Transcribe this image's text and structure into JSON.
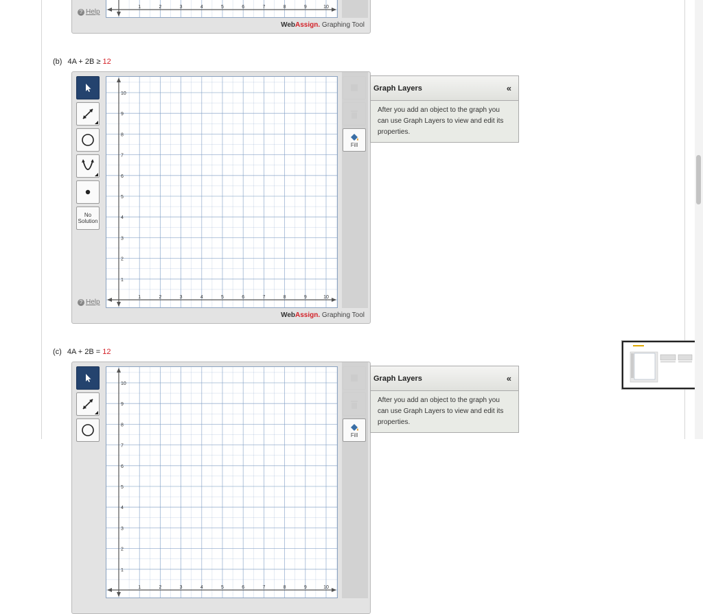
{
  "help_label": "Help",
  "brand": {
    "web": "Web",
    "assign": "Assign",
    "dot": ".",
    "rest": " Graphing Tool"
  },
  "no_solution": {
    "line1": "No",
    "line2": "Solution"
  },
  "fill_label": "Fill",
  "layers": {
    "title": "Graph Layers",
    "collapse": "«",
    "body": "After you add an object to the graph you can use Graph Layers to view and edit its properties."
  },
  "x_ticks": [
    "1",
    "2",
    "3",
    "4",
    "5",
    "6",
    "7",
    "8",
    "9",
    "10"
  ],
  "y_ticks": [
    "10",
    "9",
    "8",
    "7",
    "6",
    "5",
    "4",
    "3",
    "2",
    "1"
  ],
  "parts": {
    "b": {
      "label": "(b)",
      "expr": "4A + 2B ≥ ",
      "rhs": "12"
    },
    "c": {
      "label": "(c)",
      "expr": "4A + 2B = ",
      "rhs": "12"
    }
  },
  "colors": {
    "grid": "#7d9cc4",
    "accent": "#d32027",
    "active_tool": "#24436e"
  }
}
